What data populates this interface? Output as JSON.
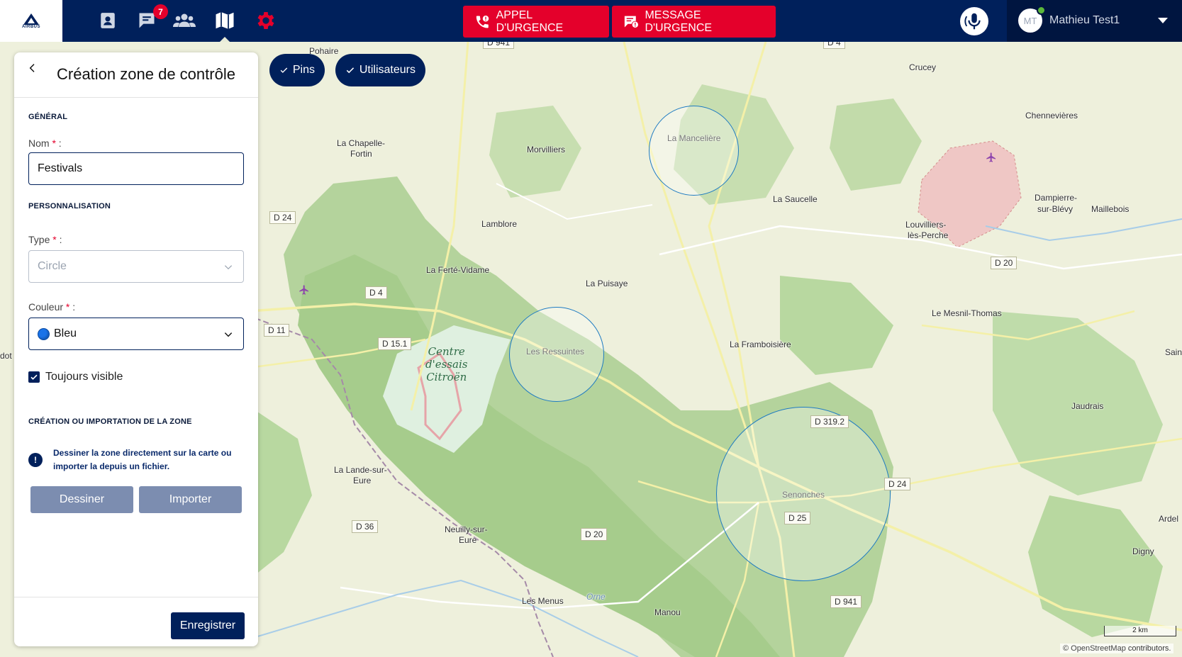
{
  "topbar": {
    "logo_text": "AIRBUS",
    "nav_icons": [
      "contacts-icon",
      "messages-icon",
      "groups-icon",
      "map-icon",
      "settings-icon"
    ],
    "messages_badge": "7",
    "emergency_call_label": "APPEL D'URGENCE",
    "emergency_message_label": "MESSAGE D'URGENCE",
    "user": {
      "initials": "MT",
      "name": "Mathieu Test1",
      "status": "online"
    },
    "colors": {
      "bar": "#00205b",
      "urgent": "#e4002b",
      "settings": "#e4002b"
    }
  },
  "map": {
    "filters": [
      {
        "label": "Pins",
        "checked": true
      },
      {
        "label": "Utilisateurs",
        "checked": true
      }
    ],
    "places": [
      "Pohaire",
      "Crucey",
      "Maillebois",
      "Chennevières",
      "La Chapelle-",
      "Fortin",
      "Morvilliers",
      "La Saucelle",
      "Dampierre-",
      "sur-Blévy",
      "Lamblore",
      "Louvilliers-",
      "lès-Perche",
      "La Ferté-Vidame",
      "La Puisaye",
      "Le Mesnil-Thomas",
      "La Framboisière",
      "Saint",
      "Jaudrais",
      "La Lande-sur-",
      "Eure",
      "Neuilly-sur-",
      "Eure",
      "Les Menus",
      "Manou",
      "Digny",
      "Ardel",
      "Orne",
      "dot"
    ],
    "roads": [
      "D 941",
      "D 4",
      "D 24",
      "D 20",
      "D 4",
      "D 11",
      "D 15.1",
      "D 319.2",
      "D 24",
      "D 25",
      "D 36",
      "D 20",
      "D 941"
    ],
    "site_label": [
      "Centre",
      "d'essais",
      "Citroën"
    ],
    "zones": [
      "La Mancelière",
      "Les Ressuintes",
      "Senonches"
    ],
    "scale": "2 km",
    "attribution_prefix": "©",
    "attribution_link": "OpenStreetMap",
    "attribution_suffix": "contributors."
  },
  "panel": {
    "title": "Création zone de contrôle",
    "general_section": "GÉNÉRAL",
    "name_label": "Nom",
    "name_value": "Festivals",
    "custom_section": "PERSONNALISATION",
    "type_label": "Type",
    "type_value": "Circle",
    "color_label": "Couleur",
    "color_value": "Bleu",
    "color_hex": "#1a73e8",
    "always_visible_label": "Toujours visible",
    "always_visible": true,
    "zone_section": "CRÉATION OU IMPORTATION DE LA ZONE",
    "info_text": "Dessiner la zone directement sur la carte ou importer la depuis un fichier.",
    "draw_label": "Dessiner",
    "import_label": "Importer",
    "save_label": "Enregistrer",
    "required_mark": "*",
    "label_suffix": " :"
  }
}
